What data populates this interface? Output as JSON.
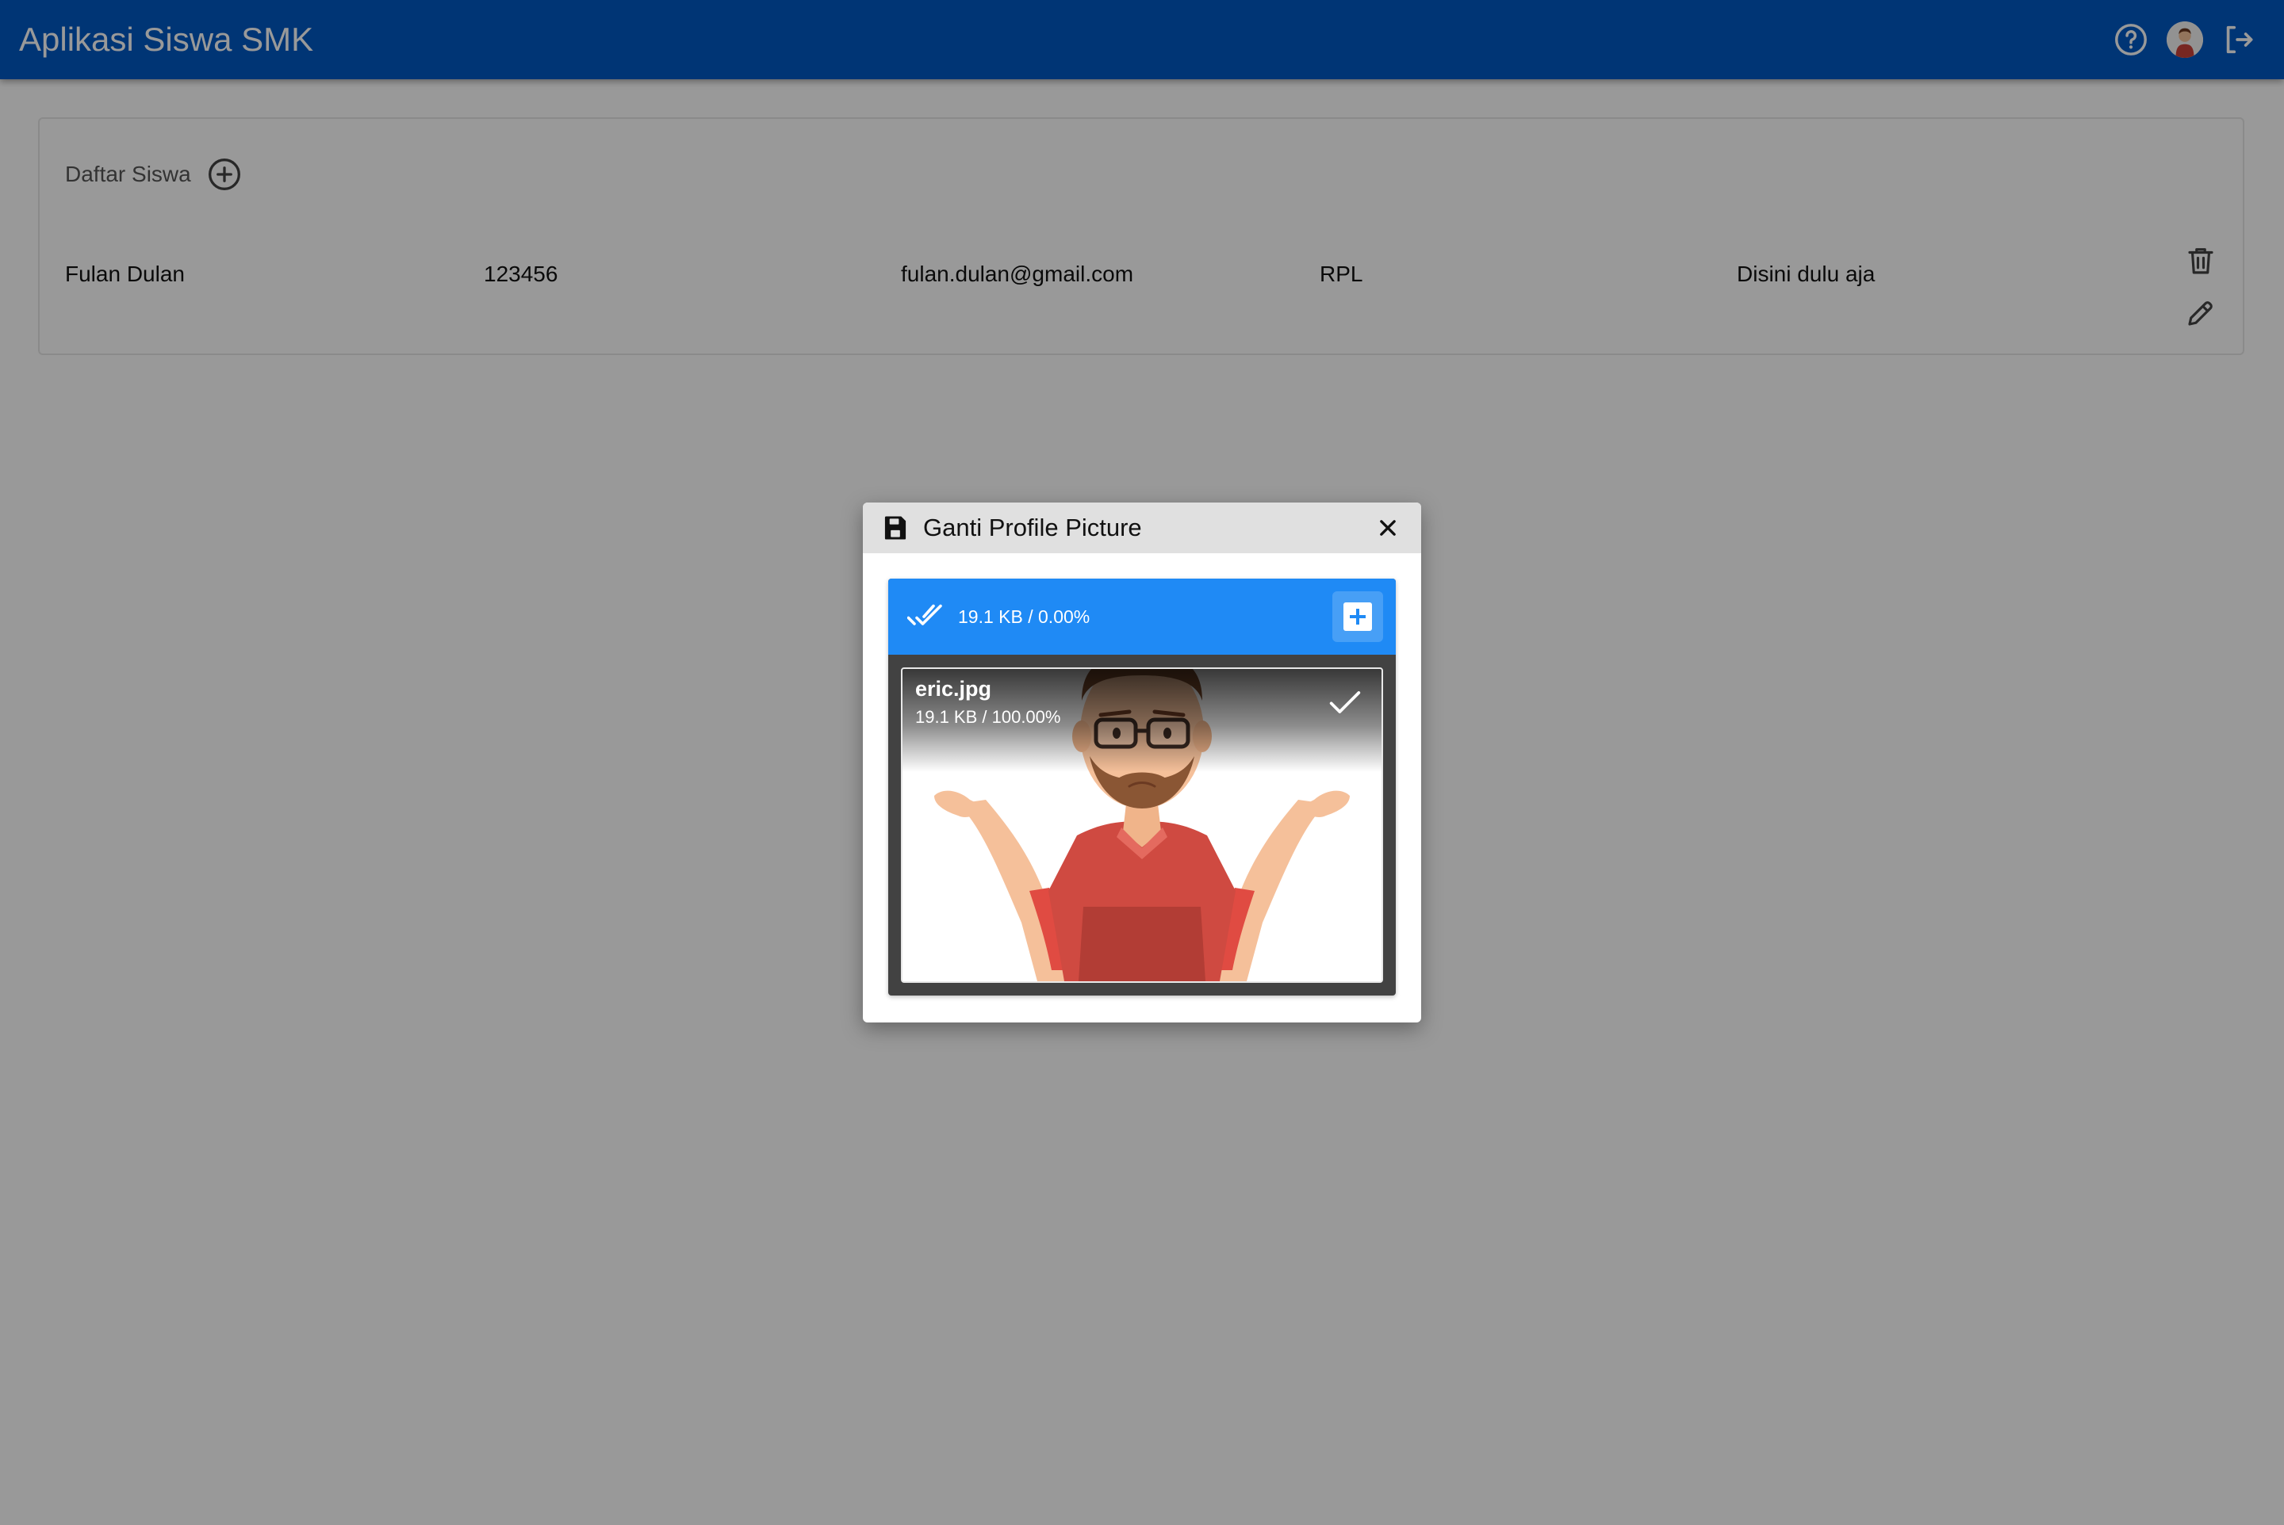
{
  "app": {
    "title": "Aplikasi Siswa SMK"
  },
  "card": {
    "title": "Daftar Siswa",
    "rows": [
      {
        "name": "Fulan Dulan",
        "nis": "123456",
        "email": "fulan.dulan@gmail.com",
        "jurusan": "RPL",
        "alamat": "Disini dulu aja"
      }
    ]
  },
  "dialog": {
    "title": "Ganti Profile Picture",
    "uploader": {
      "status": "19.1 KB / 0.00%",
      "file": {
        "name": "eric.jpg",
        "meta": "19.1 KB / 100.00%"
      }
    }
  },
  "icons": {
    "help": "help-circle-icon",
    "avatar": "avatar-icon",
    "logout": "logout-icon",
    "add": "add-circle-icon",
    "delete": "trash-icon",
    "edit": "pencil-icon",
    "save": "save-icon",
    "close": "close-icon",
    "done_all": "double-check-icon",
    "check": "check-icon",
    "add_file": "add-box-icon"
  },
  "colors": {
    "app_bar": "#0059c4",
    "uploader_header": "#1f8af5",
    "uploader_body": "#424242",
    "dialog_header": "#e0e0e0",
    "overlay": "rgba(0,0,0,0.4)"
  }
}
